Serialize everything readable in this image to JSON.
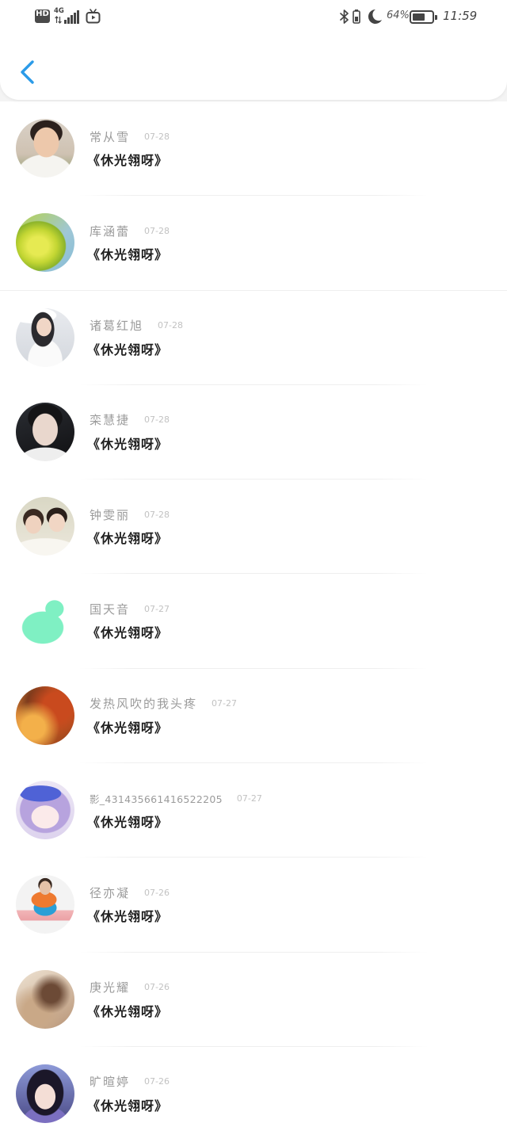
{
  "status_bar": {
    "hd_label": "HD",
    "network_label": "4G",
    "battery_text": "64%",
    "battery_level": 0.64,
    "time": "11:59",
    "icons": {
      "data_activity": "data-arrows-icon",
      "signal": "signal-bars-icon",
      "app": "tv-icon",
      "bluetooth": "bluetooth-icon",
      "vibrate": "vibrate-icon",
      "do_not_disturb": "moon-icon",
      "battery": "battery-icon"
    }
  },
  "header": {
    "back_icon": "chevron-left-icon"
  },
  "theme": {
    "accent": "#2b9be8",
    "name_color": "#9b9b9b",
    "date_color": "#c2c2c2",
    "title_color": "#1f1f1f",
    "divider_color": "#efefef"
  },
  "items": [
    {
      "name": "常从雪",
      "date": "07-28",
      "title": "《休光翎呀》"
    },
    {
      "name": "库涵蕾",
      "date": "07-28",
      "title": "《休光翎呀》"
    },
    {
      "name": "诸葛红旭",
      "date": "07-28",
      "title": "《休光翎呀》"
    },
    {
      "name": "栾慧捷",
      "date": "07-28",
      "title": "《休光翎呀》"
    },
    {
      "name": "钟雯丽",
      "date": "07-28",
      "title": "《休光翎呀》"
    },
    {
      "name": "国天音",
      "date": "07-27",
      "title": "《休光翎呀》"
    },
    {
      "name": "发热风吹的我头疼",
      "date": "07-27",
      "title": "《休光翎呀》"
    },
    {
      "name": "影_431435661416522205",
      "date": "07-27",
      "title": "《休光翎呀》"
    },
    {
      "name": "径亦凝",
      "date": "07-26",
      "title": "《休光翎呀》"
    },
    {
      "name": "庚光耀",
      "date": "07-26",
      "title": "《休光翎呀》"
    },
    {
      "name": "旷暄婷",
      "date": "07-26",
      "title": "《休光翎呀》"
    }
  ]
}
